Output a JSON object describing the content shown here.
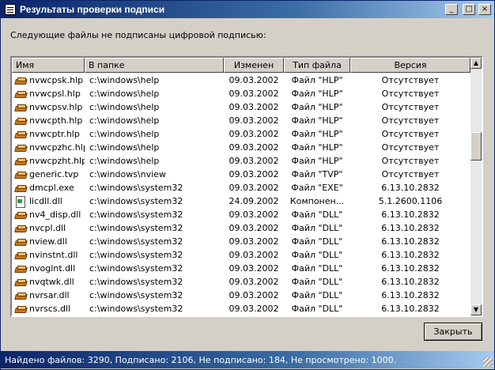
{
  "window": {
    "title": "Результаты проверки подписи",
    "min_glyph": "_",
    "max_glyph": "□",
    "close_glyph": "×"
  },
  "heading": "Следующие файлы не подписаны цифровой подписью:",
  "columns": [
    "Имя",
    "В папке",
    "Изменен",
    "Тип файла",
    "Версия"
  ],
  "rows": [
    {
      "icon": "book-icon",
      "name": "nvwcpsk.hlp",
      "folder": "c:\\windows\\help",
      "modified": "09.03.2002",
      "type": "Файл \"HLP\"",
      "version": "Отсутствует"
    },
    {
      "icon": "book-icon",
      "name": "nvwcpsl.hlp",
      "folder": "c:\\windows\\help",
      "modified": "09.03.2002",
      "type": "Файл \"HLP\"",
      "version": "Отсутствует"
    },
    {
      "icon": "book-icon",
      "name": "nvwcpsv.hlp",
      "folder": "c:\\windows\\help",
      "modified": "09.03.2002",
      "type": "Файл \"HLP\"",
      "version": "Отсутствует"
    },
    {
      "icon": "book-icon",
      "name": "nvwcpth.hlp",
      "folder": "c:\\windows\\help",
      "modified": "09.03.2002",
      "type": "Файл \"HLP\"",
      "version": "Отсутствует"
    },
    {
      "icon": "book-icon",
      "name": "nvwcptr.hlp",
      "folder": "c:\\windows\\help",
      "modified": "09.03.2002",
      "type": "Файл \"HLP\"",
      "version": "Отсутствует"
    },
    {
      "icon": "book-icon",
      "name": "nvwcpzhc.hlp",
      "folder": "c:\\windows\\help",
      "modified": "09.03.2002",
      "type": "Файл \"HLP\"",
      "version": "Отсутствует"
    },
    {
      "icon": "book-icon",
      "name": "nvwcpzht.hlp",
      "folder": "c:\\windows\\help",
      "modified": "09.03.2002",
      "type": "Файл \"HLP\"",
      "version": "Отсутствует"
    },
    {
      "icon": "book-icon",
      "name": "generic.tvp",
      "folder": "c:\\windows\\nview",
      "modified": "09.03.2002",
      "type": "Файл \"TVP\"",
      "version": "Отсутствует"
    },
    {
      "icon": "book-icon",
      "name": "dmcpl.exe",
      "folder": "c:\\windows\\system32",
      "modified": "09.03.2002",
      "type": "Файл \"EXE\"",
      "version": "6.13.10.2832"
    },
    {
      "icon": "doc-icon",
      "name": "licdll.dll",
      "folder": "c:\\windows\\system32",
      "modified": "24.09.2002",
      "type": "Компонен...",
      "version": "5.1.2600.1106"
    },
    {
      "icon": "book-icon",
      "name": "nv4_disp.dll",
      "folder": "c:\\windows\\system32",
      "modified": "09.03.2002",
      "type": "Файл \"DLL\"",
      "version": "6.13.10.2832"
    },
    {
      "icon": "book-icon",
      "name": "nvcpl.dll",
      "folder": "c:\\windows\\system32",
      "modified": "09.03.2002",
      "type": "Файл \"DLL\"",
      "version": "6.13.10.2832"
    },
    {
      "icon": "book-icon",
      "name": "nview.dll",
      "folder": "c:\\windows\\system32",
      "modified": "09.03.2002",
      "type": "Файл \"DLL\"",
      "version": "6.13.10.2832"
    },
    {
      "icon": "book-icon",
      "name": "nvinstnt.dll",
      "folder": "c:\\windows\\system32",
      "modified": "09.03.2002",
      "type": "Файл \"DLL\"",
      "version": "6.13.10.2832"
    },
    {
      "icon": "book-icon",
      "name": "nvoglnt.dll",
      "folder": "c:\\windows\\system32",
      "modified": "09.03.2002",
      "type": "Файл \"DLL\"",
      "version": "6.13.10.2832"
    },
    {
      "icon": "book-icon",
      "name": "nvqtwk.dll",
      "folder": "c:\\windows\\system32",
      "modified": "09.03.2002",
      "type": "Файл \"DLL\"",
      "version": "6.13.10.2832"
    },
    {
      "icon": "book-icon",
      "name": "nvrsar.dll",
      "folder": "c:\\windows\\system32",
      "modified": "09.03.2002",
      "type": "Файл \"DLL\"",
      "version": "6.13.10.2832"
    },
    {
      "icon": "book-icon",
      "name": "nvrscs.dll",
      "folder": "c:\\windows\\system32",
      "modified": "09.03.2002",
      "type": "Файл \"DLL\"",
      "version": "6.13.10.2832"
    }
  ],
  "scrollbar": {
    "up_glyph": "▲",
    "down_glyph": "▼"
  },
  "close_button": "Закрыть",
  "status": "Найдено файлов: 3290, Подписано: 2106, Не подписано: 184, Не просмотрено: 1000."
}
